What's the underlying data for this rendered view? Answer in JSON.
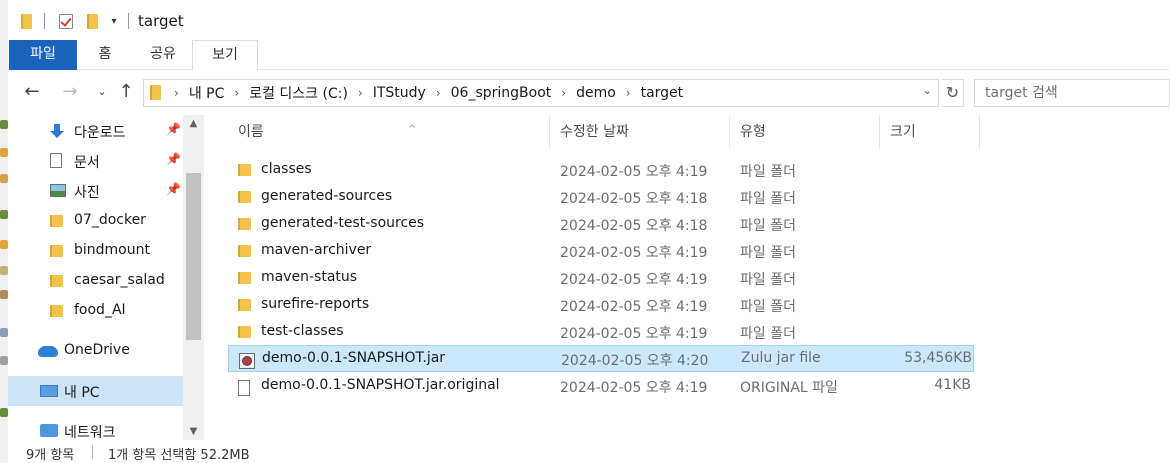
{
  "window": {
    "title": "target"
  },
  "ribbon": {
    "tabs": [
      "파일",
      "홈",
      "공유",
      "보기"
    ]
  },
  "address": {
    "crumbs": [
      "내 PC",
      "로컬 디스크 (C:)",
      "ITStudy",
      "06_springBoot",
      "demo",
      "target"
    ],
    "search_placeholder": "target 검색"
  },
  "nav": {
    "items": [
      {
        "label": "다운로드",
        "icon": "download-icon",
        "pinned": true
      },
      {
        "label": "문서",
        "icon": "document-icon",
        "pinned": true
      },
      {
        "label": "사진",
        "icon": "pictures-icon",
        "pinned": true
      },
      {
        "label": "07_docker",
        "icon": "folder-icon",
        "pinned": false
      },
      {
        "label": "bindmount",
        "icon": "folder-icon",
        "pinned": false
      },
      {
        "label": "caesar_salad",
        "icon": "folder-icon",
        "pinned": false
      },
      {
        "label": "food_AI",
        "icon": "folder-icon",
        "pinned": false
      },
      {
        "label": "OneDrive",
        "icon": "onedrive-icon",
        "pinned": false
      },
      {
        "label": "내 PC",
        "icon": "this-pc-icon",
        "pinned": false,
        "selected": true
      },
      {
        "label": "네트워크",
        "icon": "network-icon",
        "pinned": false
      }
    ]
  },
  "list": {
    "columns": {
      "name": "이름",
      "date": "수정한 날짜",
      "type": "유형",
      "size": "크기"
    },
    "rows": [
      {
        "name": "classes",
        "date": "2024-02-05 오후 4:19",
        "type": "파일 폴더",
        "size": "",
        "kind": "folder"
      },
      {
        "name": "generated-sources",
        "date": "2024-02-05 오후 4:18",
        "type": "파일 폴더",
        "size": "",
        "kind": "folder"
      },
      {
        "name": "generated-test-sources",
        "date": "2024-02-05 오후 4:18",
        "type": "파일 폴더",
        "size": "",
        "kind": "folder"
      },
      {
        "name": "maven-archiver",
        "date": "2024-02-05 오후 4:19",
        "type": "파일 폴더",
        "size": "",
        "kind": "folder"
      },
      {
        "name": "maven-status",
        "date": "2024-02-05 오후 4:19",
        "type": "파일 폴더",
        "size": "",
        "kind": "folder"
      },
      {
        "name": "surefire-reports",
        "date": "2024-02-05 오후 4:19",
        "type": "파일 폴더",
        "size": "",
        "kind": "folder"
      },
      {
        "name": "test-classes",
        "date": "2024-02-05 오후 4:19",
        "type": "파일 폴더",
        "size": "",
        "kind": "folder"
      },
      {
        "name": "demo-0.0.1-SNAPSHOT.jar",
        "date": "2024-02-05 오후 4:20",
        "type": "Zulu jar file",
        "size": "53,456KB",
        "kind": "jar",
        "selected": true
      },
      {
        "name": "demo-0.0.1-SNAPSHOT.jar.original",
        "date": "2024-02-05 오후 4:19",
        "type": "ORIGINAL 파일",
        "size": "41KB",
        "kind": "file"
      }
    ]
  },
  "status": {
    "count": "9개 항목",
    "selection": "1개 항목 선택함 52.2MB"
  }
}
